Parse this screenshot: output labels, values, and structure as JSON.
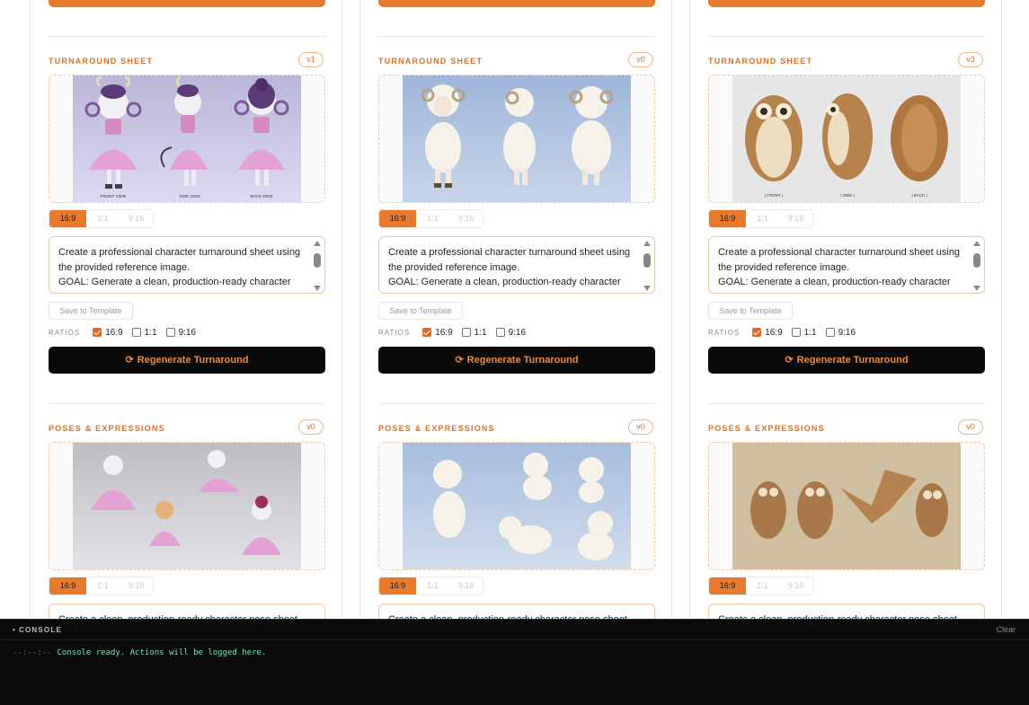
{
  "columns": [
    {
      "turnaround": {
        "title": "TURNAROUND SHEET",
        "version": "v1",
        "image": "cow-character-turnaround",
        "view_labels": [
          "FRONT VIEW",
          "SIDE VIEW",
          "BACK VIEW"
        ],
        "ratio_tabs": [
          "16:9",
          "1:1",
          "9:16"
        ],
        "active_tab": "16:9",
        "prompt": "Create a professional character turnaround sheet using the provided reference image.\nGOAL: Generate a clean, production-ready character",
        "save_label": "Save to Template",
        "ratios_label": "RATIOS",
        "ratios": [
          {
            "label": "16:9",
            "checked": true
          },
          {
            "label": "1:1",
            "checked": false
          },
          {
            "label": "9:16",
            "checked": false
          }
        ],
        "regen_label": "Regenerate Turnaround"
      },
      "poses": {
        "title": "POSES & EXPRESSIONS",
        "version": "v0",
        "image": "cow-poses",
        "ratio_tabs": [
          "16:9",
          "1:1",
          "9:16"
        ],
        "active_tab": "16:9",
        "prompt": "Create a clean, production-ready character pose sheet"
      }
    },
    {
      "turnaround": {
        "title": "TURNAROUND SHEET",
        "version": "v0",
        "image": "sheep-character-turnaround",
        "view_labels": [],
        "ratio_tabs": [
          "16:9",
          "1:1",
          "9:16"
        ],
        "active_tab": "16:9",
        "prompt": "Create a professional character turnaround sheet using the provided reference image.\nGOAL: Generate a clean, production-ready character",
        "save_label": "Save to Template",
        "ratios_label": "RATIOS",
        "ratios": [
          {
            "label": "16:9",
            "checked": true
          },
          {
            "label": "1:1",
            "checked": false
          },
          {
            "label": "9:16",
            "checked": false
          }
        ],
        "regen_label": "Regenerate Turnaround"
      },
      "poses": {
        "title": "POSES & EXPRESSIONS",
        "version": "v0",
        "image": "sheep-poses",
        "ratio_tabs": [
          "16:9",
          "1:1",
          "9:16"
        ],
        "active_tab": "16:9",
        "prompt": "Create a clean, production-ready character pose sheet"
      }
    },
    {
      "turnaround": {
        "title": "TURNAROUND SHEET",
        "version": "v3",
        "image": "owl-character-turnaround",
        "view_labels": [
          "| FRONT |",
          "| SIDE |",
          "| BACK |"
        ],
        "ratio_tabs": [
          "16:9",
          "1:1",
          "9:16"
        ],
        "active_tab": "16:9",
        "prompt": "Create a professional character turnaround sheet using the provided reference image.\nGOAL: Generate a clean, production-ready character",
        "save_label": "Save to Template",
        "ratios_label": "RATIOS",
        "ratios": [
          {
            "label": "16:9",
            "checked": true
          },
          {
            "label": "1:1",
            "checked": false
          },
          {
            "label": "9:16",
            "checked": false
          }
        ],
        "regen_label": "Regenerate Turnaround"
      },
      "poses": {
        "title": "POSES & EXPRESSIONS",
        "version": "v0",
        "image": "owl-poses",
        "ratio_tabs": [
          "16:9",
          "1:1",
          "9:16"
        ],
        "active_tab": "16:9",
        "prompt": "Create a clean, production-ready character pose sheet"
      }
    }
  ],
  "console": {
    "title": "CONSOLE",
    "clear_label": "Clear",
    "entries": [
      {
        "time": "--:--:--",
        "message": "Console ready. Actions will be logged here."
      }
    ]
  },
  "colors": {
    "accent": "#e67a2e",
    "button_bg": "#0a0a0a",
    "console_bg": "#0b0b0b",
    "console_text": "#7fe0b0"
  }
}
